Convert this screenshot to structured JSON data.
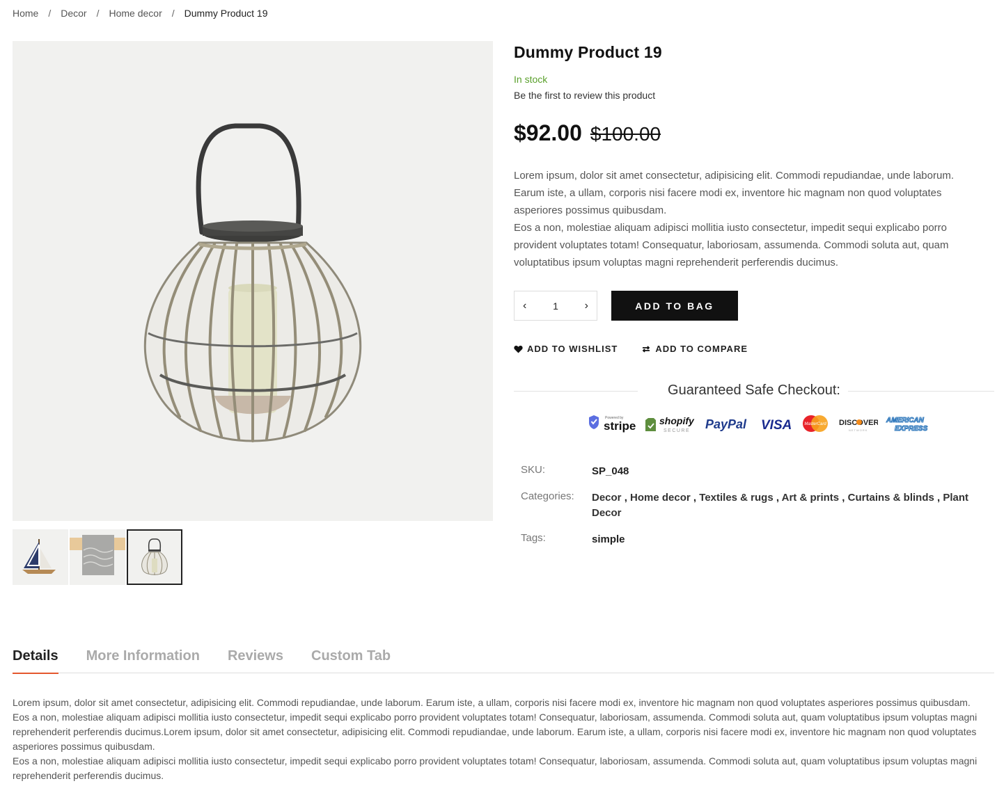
{
  "breadcrumb": {
    "items": [
      "Home",
      "Decor",
      "Home decor"
    ],
    "separator": "/",
    "current": "Dummy Product 19"
  },
  "product": {
    "title": "Dummy Product 19",
    "stock": "In stock",
    "review_link": "Be the first to review this product",
    "price": "$92.00",
    "old_price": "$100.00",
    "description_1": "Lorem ipsum, dolor sit amet consectetur, adipisicing elit. Commodi repudiandae, unde laborum. Earum iste, a ullam, corporis nisi facere modi ex, inventore hic magnam non quod voluptates asperiores possimus quibusdam.",
    "description_2": "Eos a non, molestiae aliquam adipisci mollitia iusto consectetur, impedit sequi explicabo porro provident voluptates totam! Consequatur, laboriosam, assumenda. Commodi soluta aut, quam voluptatibus ipsum voluptas magni reprehenderit perferendis ducimus."
  },
  "cart": {
    "qty": "1",
    "minus": "‹",
    "plus": "›",
    "add_to_bag": "ADD TO BAG",
    "wishlist": "ADD TO WISHLIST",
    "compare": "ADD TO COMPARE"
  },
  "checkout": {
    "heading": "Guaranteed Safe Checkout:",
    "badges": [
      "Powered by",
      "stripe",
      "shopify",
      "SECURE",
      "PayPal",
      "VISA",
      "MasterCard",
      "DISCOVER",
      "NETWORK",
      "AMERICAN",
      "EXPRESS"
    ]
  },
  "meta": {
    "sku_label": "SKU:",
    "sku_value": "SP_048",
    "categories_label": "Categories:",
    "categories": [
      "Decor",
      "Home decor",
      "Textiles & rugs",
      "Art & prints",
      "Curtains & blinds",
      "Plant Decor"
    ],
    "category_sep": " , ",
    "tags_label": "Tags:",
    "tags_value": "simple"
  },
  "tabs": {
    "items": [
      "Details",
      "More Information",
      "Reviews",
      "Custom Tab"
    ],
    "active": "Details"
  },
  "details": {
    "p1": "Lorem ipsum, dolor sit amet consectetur, adipisicing elit. Commodi repudiandae, unde laborum. Earum iste, a ullam, corporis nisi facere modi ex, inventore hic magnam non quod voluptates asperiores possimus quibusdam.",
    "p2": "Eos a non, molestiae aliquam adipisci mollitia iusto consectetur, impedit sequi explicabo porro provident voluptates totam! Consequatur, laboriosam, assumenda. Commodi soluta aut, quam voluptatibus ipsum voluptas magni reprehenderit perferendis ducimus.Lorem ipsum, dolor sit amet consectetur, adipisicing elit. Commodi repudiandae, unde laborum. Earum iste, a ullam, corporis nisi facere modi ex, inventore hic magnam non quod voluptates asperiores possimus quibusdam.",
    "p3": "Eos a non, molestiae aliquam adipisci mollitia iusto consectetur, impedit sequi explicabo porro provident voluptates totam! Consequatur, laboriosam, assumenda. Commodi soluta aut, quam voluptatibus ipsum voluptas magni reprehenderit perferendis ducimus."
  },
  "colors": {
    "stock_green": "#5aa02c",
    "tab_accent": "#e4572e",
    "button_dark": "#111111"
  },
  "icons": {
    "wishlist": "heart-icon",
    "compare": "compare-icon"
  }
}
